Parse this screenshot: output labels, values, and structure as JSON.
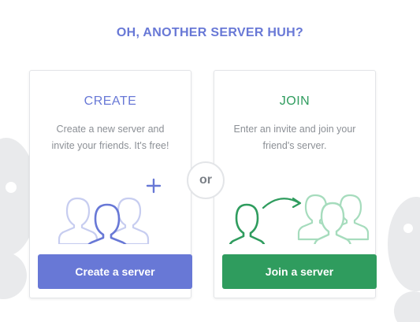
{
  "heading": "OH, ANOTHER SERVER HUH?",
  "create": {
    "title": "CREATE",
    "desc_line1": "Create a new server and",
    "desc_line2": "invite your friends. It's free!",
    "button": "Create a server",
    "icon": "group-plus-icon"
  },
  "join": {
    "title": "JOIN",
    "desc_line1": "Enter an invite and join your",
    "desc_line2": "friend's server.",
    "button": "Join a server",
    "icon": "user-arrow-group-icon"
  },
  "divider": "or",
  "colors": {
    "create_accent": "#6878d6",
    "join_accent": "#2f9c5e",
    "border": "#e3e5e8",
    "muted_text": "#8c9096"
  }
}
